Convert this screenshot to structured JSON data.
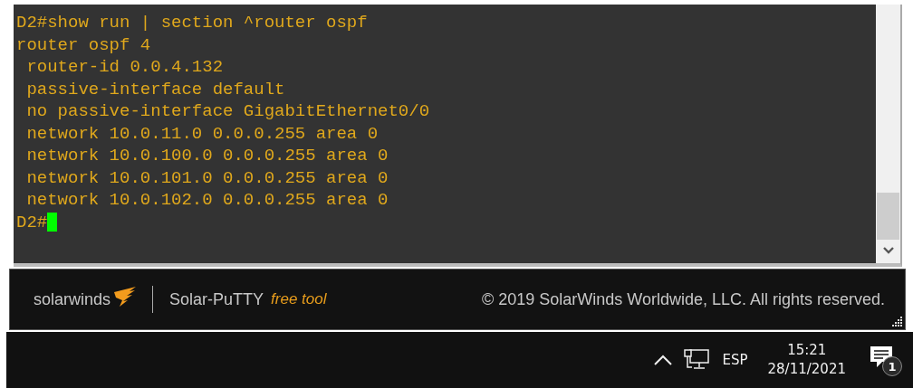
{
  "terminal": {
    "lines": [
      "D2#show run | section ^router ospf",
      "router ospf 4",
      " router-id 0.0.4.132",
      " passive-interface default",
      " no passive-interface GigabitEthernet0/0",
      " network 10.0.11.0 0.0.0.255 area 0",
      " network 10.0.100.0 0.0.0.255 area 0",
      " network 10.0.101.0 0.0.0.255 area 0",
      " network 10.0.102.0 0.0.0.255 area 0"
    ],
    "prompt": "D2#"
  },
  "footer": {
    "brand": "solarwinds",
    "product": "Solar-PuTTY",
    "tagline": "free tool",
    "copyright": "© 2019 SolarWinds Worldwide, LLC. All rights reserved."
  },
  "taskbar": {
    "language": "ESP",
    "time": "15:21",
    "date": "28/11/2021",
    "notification_count": "1"
  }
}
